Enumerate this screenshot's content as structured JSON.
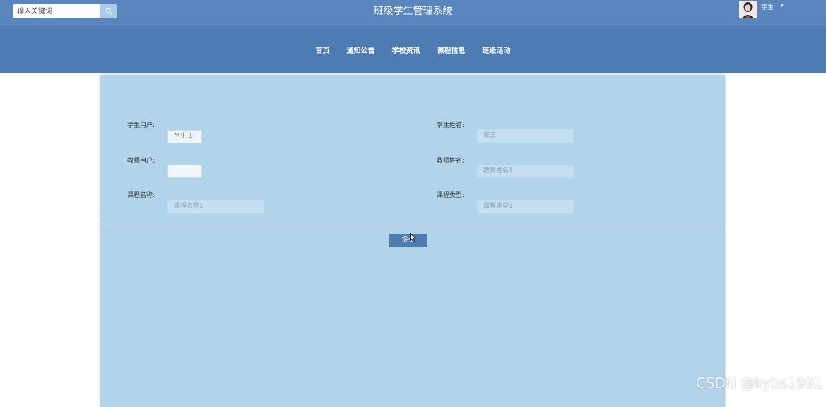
{
  "header": {
    "search_placeholder": "输入关键词",
    "title": "班级学生管理系统",
    "user_name": "学生",
    "user_caret": "▾"
  },
  "nav": {
    "items": [
      "首页",
      "通知公告",
      "学校资讯",
      "课程信息",
      "班级活动"
    ]
  },
  "form": {
    "student_user_label": "学生用户:",
    "student_user_value": "学生 1:",
    "student_name_label": "学生姓名:",
    "student_name_value": "张三",
    "teacher_user_label": "教师用户:",
    "teacher_user_value": "",
    "teacher_name_label": "教师姓名:",
    "teacher_name_value": "教师姓名1",
    "course_name_label": "课程名称:",
    "course_name_value": "课程名称1",
    "course_type_label": "课程类型:",
    "course_type_value": "课程类型1",
    "submit_label": "提交"
  },
  "watermark": "CSDN @kybs1991",
  "colors": {
    "topbar": "#5b86bd",
    "navbar": "#4c7cb2",
    "content_bg": "#b1d4eb",
    "button": "#4c7cb2"
  }
}
